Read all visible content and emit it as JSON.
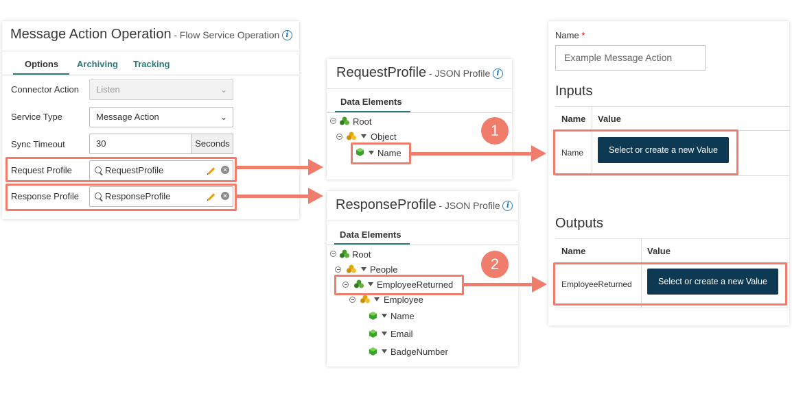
{
  "operation_panel": {
    "title": "Message Action Operation",
    "subtitle": "- Flow Service Operation",
    "tabs": [
      "Options",
      "Archiving",
      "Tracking"
    ],
    "active_tab": "Options",
    "fields": {
      "connector_action_label": "Connector Action",
      "connector_action_value": "Listen",
      "service_type_label": "Service Type",
      "service_type_value": "Message Action",
      "sync_timeout_label": "Sync Timeout",
      "sync_timeout_value": "30",
      "sync_timeout_unit": "Seconds",
      "request_profile_label": "Request Profile",
      "request_profile_value": "RequestProfile",
      "response_profile_label": "Response Profile",
      "response_profile_value": "ResponseProfile"
    }
  },
  "request_profile": {
    "title": "RequestProfile",
    "subtitle": "- JSON Profile",
    "tab": "Data Elements",
    "tree": {
      "root": "Root",
      "object": "Object",
      "name": "Name"
    }
  },
  "response_profile": {
    "title": "ResponseProfile",
    "subtitle": "- JSON Profile",
    "tab": "Data Elements",
    "tree": {
      "root": "Root",
      "people": "People",
      "employee_returned": "EmployeeReturned",
      "employee": "Employee",
      "name": "Name",
      "email": "Email",
      "badge_number": "BadgeNumber"
    }
  },
  "callouts": {
    "one": "1",
    "two": "2"
  },
  "action_panel": {
    "name_label": "Name",
    "required_mark": "*",
    "name_placeholder": "Example Message Action",
    "inputs": {
      "title": "Inputs",
      "col_name": "Name",
      "col_value": "Value",
      "row_name": "Name",
      "button": "Select or create a new Value"
    },
    "outputs": {
      "title": "Outputs",
      "col_name": "Name",
      "col_value": "Value",
      "row_name": "EmployeeReturned",
      "button": "Select or create a new Value"
    }
  },
  "colors": {
    "highlight": "#f07c6c",
    "tab_accent": "#2a7b7a",
    "button_dark": "#0d3a52",
    "info_icon": "#2a7ab0"
  }
}
